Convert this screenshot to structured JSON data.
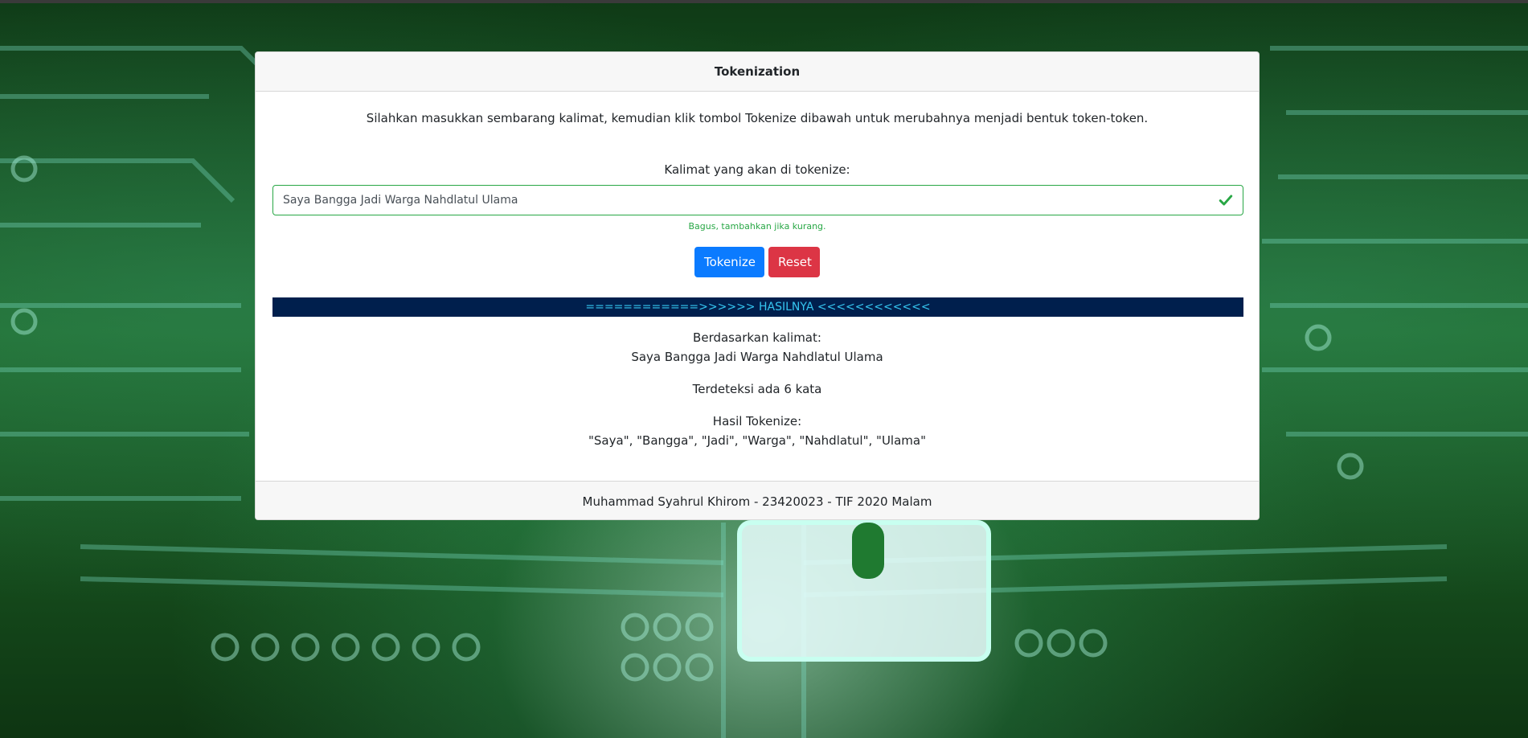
{
  "card": {
    "title": "Tokenization",
    "intro": "Silahkan masukkan sembarang kalimat, kemudian klik tombol Tokenize dibawah untuk merubahnya menjadi bentuk token-token.",
    "input_label": "Kalimat yang akan di tokenize:",
    "input_value": "Saya Bangga Jadi Warga Nahdlatul Ulama",
    "feedback": "Bagus, tambahkan jika kurang.",
    "tokenize_label": "Tokenize",
    "reset_label": "Reset",
    "result_header": "============>>>>>> HASILNYA <<<<<<<<<<<<",
    "based_on_label": "Berdasarkan kalimat:",
    "based_on_value": "Saya Bangga Jadi Warga Nahdlatul Ulama",
    "detected": "Terdeteksi ada 6 kata",
    "result_label": "Hasil Tokenize:",
    "result_value": "\"Saya\", \"Bangga\", \"Jadi\", \"Warga\", \"Nahdlatul\", \"Ulama\"",
    "footer": "Muhammad Syahrul Khirom - 23420023 - TIF 2020 Malam"
  },
  "colors": {
    "primary": "#0b7bff",
    "danger": "#dc3545",
    "success": "#28a745",
    "result_bar_bg": "#001f4d",
    "result_bar_text": "#35c6f0"
  },
  "icons": {
    "input_status": "check-icon"
  }
}
